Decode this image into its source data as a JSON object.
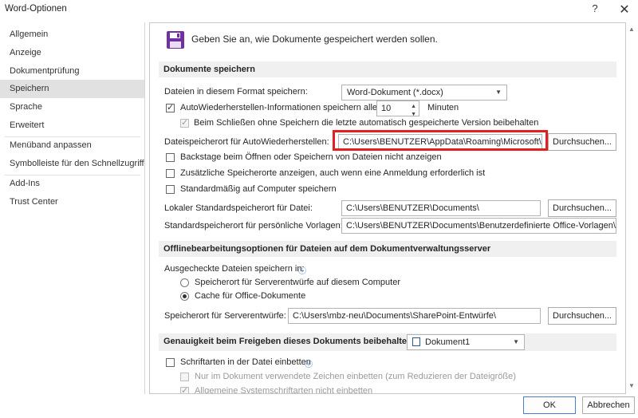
{
  "window": {
    "title": "Word-Optionen",
    "help_label": "?",
    "close_label": "✕"
  },
  "nav": {
    "items": [
      {
        "label": "Allgemein"
      },
      {
        "label": "Anzeige"
      },
      {
        "label": "Dokumentprüfung"
      },
      {
        "label": "Speichern",
        "active": true
      },
      {
        "label": "Sprache"
      },
      {
        "label": "Erweitert"
      },
      {
        "label": "Menüband anpassen"
      },
      {
        "label": "Symbolleiste für den Schnellzugriff"
      },
      {
        "label": "Add-Ins"
      },
      {
        "label": "Trust Center"
      }
    ]
  },
  "header": {
    "text": "Geben Sie an, wie Dokumente gespeichert werden sollen."
  },
  "save_section": {
    "title": "Dokumente speichern",
    "format_label": "Dateien in diesem Format speichern:",
    "format_value": "Word-Dokument (*.docx)",
    "autorecover_label": "AutoWiederherstellen-Informationen speichern alle",
    "autorecover_checked": true,
    "autorecover_minutes": "10",
    "minutes_label": "Minuten",
    "keep_last_label": "Beim Schließen ohne Speichern die letzte automatisch gespeicherte Version beibehalten",
    "keep_last_checked": true,
    "autorecover_path_label": "Dateispeicherort für AutoWiederherstellen:",
    "autorecover_path_value": "C:\\Users\\BENUTZER\\AppData\\Roaming\\Microsoft\\Wo",
    "browse_label": "Durchsuchen...",
    "backstage_label": "Backstage beim Öffnen oder Speichern von Dateien nicht anzeigen",
    "backstage_checked": false,
    "additional_locations_label": "Zusätzliche Speicherorte anzeigen, auch wenn eine Anmeldung erforderlich ist",
    "additional_locations_checked": false,
    "default_computer_label": "Standardmäßig auf Computer speichern",
    "default_computer_checked": false,
    "local_default_label": "Lokaler Standardspeicherort für Datei:",
    "local_default_value": "C:\\Users\\BENUTZER\\Documents\\",
    "browse2_label": "Durchsuchen...",
    "templates_label": "Standardspeicherort für persönliche Vorlagen:",
    "templates_value": "C:\\Users\\BENUTZER\\Documents\\Benutzerdefinierte Office-Vorlagen\\"
  },
  "offline_section": {
    "title": "Offlinebearbeitungsoptionen für Dateien auf dem Dokumentverwaltungsserver",
    "checked_out_label": "Ausgecheckte Dateien speichern in:",
    "info_icon": "info-icon",
    "radio1_label": "Speicherort für Serverentwürfe auf diesem Computer",
    "radio2_label": "Cache für Office-Dokumente",
    "selected": "radio2",
    "server_drafts_label": "Speicherort für Serverentwürfe:",
    "server_drafts_value": "C:\\Users\\mbz-neu\\Documents\\SharePoint-Entwürfe\\",
    "browse3_label": "Durchsuchen..."
  },
  "fidelity_section": {
    "title": "Genauigkeit beim Freigeben dieses Dokuments beibehalten:",
    "document_value": "Dokument1",
    "embed_fonts_label": "Schriftarten in der Datei einbetten",
    "embed_fonts_checked": false,
    "only_used_label": "Nur im Dokument verwendete Zeichen einbetten (zum Reduzieren der Dateigröße)",
    "only_used_checked": false,
    "no_system_fonts_label": "Allgemeine Systemschriftarten nicht einbetten",
    "no_system_fonts_checked": true
  },
  "footer": {
    "ok_label": "OK",
    "cancel_label": "Abbrechen"
  },
  "colors": {
    "accent": "#7030a0",
    "highlight": "#e31f1f",
    "nav_active": "#e1e1e1",
    "section_bg": "#f0f0f0"
  }
}
